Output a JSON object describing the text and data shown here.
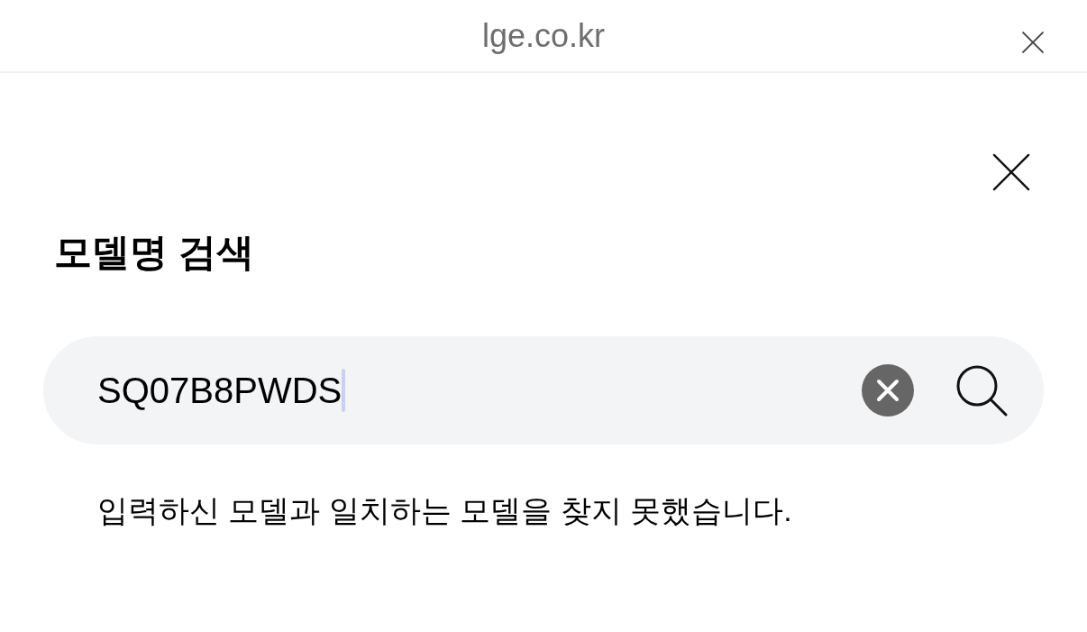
{
  "browser_bar": {
    "url": "lge.co.kr"
  },
  "dialog": {
    "title": "모델명 검색",
    "search": {
      "value": "SQ07B8PWDS",
      "focused": true
    },
    "message": "입력하신 모델과 일치하는 모델을 찾지 못했습니다."
  }
}
